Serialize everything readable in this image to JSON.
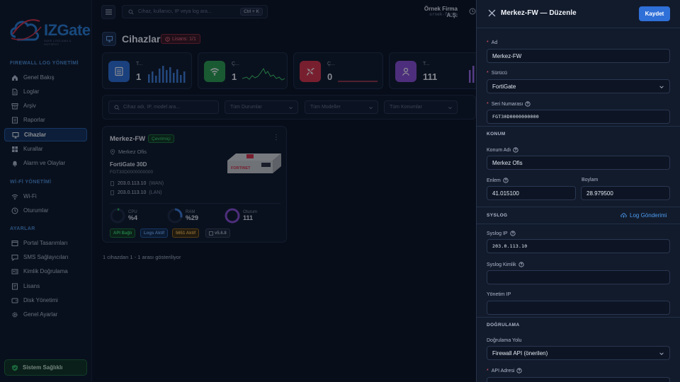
{
  "brand": {
    "logo_text": "IZGate",
    "logo_sub": "SAFE LOGLAMA & HOTSPOT"
  },
  "sidebar": {
    "sections": [
      {
        "title": "FIREWALL LOG YÖNETİMİ",
        "items": [
          {
            "label": "Genel Bakış",
            "icon": "home-icon"
          },
          {
            "label": "Loglar",
            "icon": "file-icon"
          },
          {
            "label": "Arşiv",
            "icon": "archive-icon"
          },
          {
            "label": "Raporlar",
            "icon": "report-icon"
          },
          {
            "label": "Cihazlar",
            "icon": "monitor-icon",
            "active": true
          },
          {
            "label": "Kurallar",
            "icon": "rules-icon"
          },
          {
            "label": "Alarm ve Olaylar",
            "icon": "bell-icon"
          }
        ]
      },
      {
        "title": "Wİ-Fİ YÖNETİMİ",
        "items": [
          {
            "label": "Wi-Fi",
            "icon": "wifi-icon"
          },
          {
            "label": "Oturumlar",
            "icon": "clock-icon"
          }
        ]
      },
      {
        "title": "AYARLAR",
        "items": [
          {
            "label": "Portal Tasarımları",
            "icon": "portal-icon"
          },
          {
            "label": "SMS Sağlayıcıları",
            "icon": "sms-icon"
          },
          {
            "label": "Kimlik Doğrulama",
            "icon": "id-icon"
          },
          {
            "label": "Lisans",
            "icon": "license-icon"
          },
          {
            "label": "Disk Yönetimi",
            "icon": "disk-icon"
          },
          {
            "label": "Genel Ayarlar",
            "icon": "gear-icon"
          }
        ]
      }
    ],
    "system_health": "Sistem Sağlıklı"
  },
  "topbar": {
    "search_placeholder": "Cihaz, kullanıcı, IP veya log ara...",
    "shortcut": "Ctrl + K",
    "company": "Örnek Firma A.Ş.",
    "company_sub": "ornek-firma"
  },
  "page": {
    "title": "Cihazlar",
    "license_badge": "Lisans: 1/1"
  },
  "stats": [
    {
      "label": "T...",
      "value": "1",
      "color": "#2f6fd8",
      "icon": "server-icon"
    },
    {
      "label": "Ç...",
      "value": "1",
      "color": "#2f9e4f",
      "icon": "wifi-icon"
    },
    {
      "label": "Ç...",
      "value": "0",
      "color": "#d9334a",
      "icon": "unlink-icon"
    },
    {
      "label": "T...",
      "value": "111",
      "color": "#8a4fd6",
      "icon": "users-icon"
    }
  ],
  "filters": {
    "search_placeholder": "Cihaz adı, IP, model ara...",
    "status": "Tüm Durumlar",
    "models": "Tüm Modeller",
    "locations": "Tüm Konumlar"
  },
  "device": {
    "name": "Merkez-FW",
    "status": "Çevrimiçi",
    "location": "Merkez Ofis",
    "model": "FortiGate 30D",
    "serial": "FGT30D0000000000",
    "wan_ip": "203.0.113.10",
    "wan_label": "(WAN)",
    "lan_ip": "203.0.113.10",
    "lan_label": "(LAN)",
    "cpu_label": "CPU",
    "cpu_value": "%4",
    "cpu_pct": 4,
    "ram_label": "RAM",
    "ram_value": "%29",
    "ram_pct": 29,
    "session_label": "Oturum",
    "session_value": "111",
    "tags": [
      "API Bağlı",
      "Logs Aktif",
      "5651 Aktif",
      "v5.6.8"
    ],
    "image_brand": "FORTINET"
  },
  "summary": "1 cihazdan 1 - 1 arası gösteriliyor",
  "drawer": {
    "title": "Merkez-FW — Düzenle",
    "save": "Kaydet",
    "name_label": "Ad",
    "name_value": "Merkez-FW",
    "driver_label": "Sürücü",
    "driver_value": "FortiGate",
    "serial_label": "Seri Numarası",
    "serial_value": "FGT30D0000000000",
    "location_section": "KONUM",
    "location_name_label": "Konum Adı",
    "location_name_value": "Merkez Ofis",
    "lat_label": "Enlem",
    "lat_value": "41.015100",
    "lon_label": "Boylam",
    "lon_value": "28.979500",
    "syslog_section": "SYSLOG",
    "log_send": "Log Gönderimi",
    "syslog_ip_label": "Syslog IP",
    "syslog_ip_value": "203.0.113.10",
    "syslog_id_label": "Syslog Kimlik",
    "syslog_id_value": "",
    "mgmt_ip_label": "Yönetim IP",
    "mgmt_ip_value": "",
    "auth_section": "DOĞRULAMA",
    "auth_method_label": "Doğrulama Yolu",
    "auth_method_value": "Firewall API (önerilen)",
    "api_address_label": "API Adresi"
  }
}
